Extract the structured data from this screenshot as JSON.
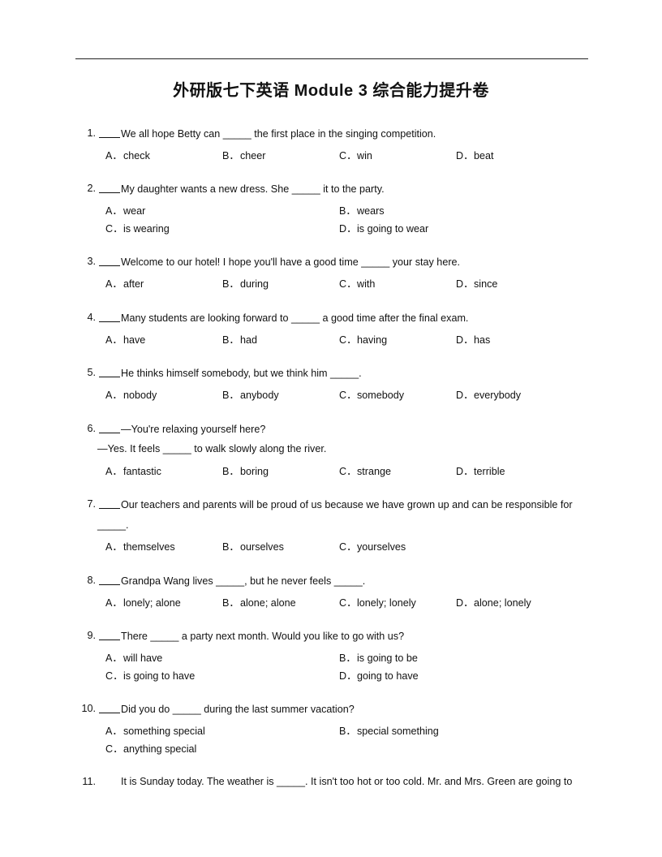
{
  "document": {
    "title_cn_prefix": "外研版七下英语",
    "title_en": "Module 3",
    "title_cn_suffix": "综合能力提升卷"
  },
  "questions": [
    {
      "number": "1.",
      "stem": "We all hope  Betty can _____ the first place in the singing competition.",
      "options": [
        {
          "letter": "A．",
          "text": "check"
        },
        {
          "letter": "B．",
          "text": "cheer"
        },
        {
          "letter": "C．",
          "text": "win"
        },
        {
          "letter": "D．",
          "text": "beat"
        }
      ]
    },
    {
      "number": "2.",
      "stem": "My daughter wants a new dress. She _____ it to the party.",
      "options": [
        {
          "letter": "A．",
          "text": "wear"
        },
        {
          "letter": "B．",
          "text": "wears"
        },
        {
          "letter": "C．",
          "text": "is wearing"
        },
        {
          "letter": "D．",
          "text": "is going to wear"
        }
      ]
    },
    {
      "number": "3.",
      "stem": "Welcome to our hotel! I hope you'll have a good time _____ your stay here.",
      "options": [
        {
          "letter": "A．",
          "text": "after"
        },
        {
          "letter": "B．",
          "text": "during"
        },
        {
          "letter": "C．",
          "text": "with"
        },
        {
          "letter": "D．",
          "text": "since"
        }
      ]
    },
    {
      "number": "4.",
      "stem": "Many students are looking forward to _____ a good time after the final exam.",
      "options": [
        {
          "letter": "A．",
          "text": "have"
        },
        {
          "letter": "B．",
          "text": "had"
        },
        {
          "letter": "C．",
          "text": "having"
        },
        {
          "letter": "D．",
          "text": "has"
        }
      ]
    },
    {
      "number": "5.",
      "stem": "He thinks himself somebody,  but we think him _____.",
      "options": [
        {
          "letter": "A．",
          "text": "nobody"
        },
        {
          "letter": "B．",
          "text": "anybody"
        },
        {
          "letter": "C．",
          "text": "somebody"
        },
        {
          "letter": "D．",
          "text": "everybody"
        }
      ]
    },
    {
      "number": "6.",
      "stem": "—You're relaxing yourself here?",
      "stem_line2": "—Yes. It feels _____ to walk slowly along the river.",
      "options": [
        {
          "letter": "A．",
          "text": "fantastic"
        },
        {
          "letter": "B．",
          "text": "boring"
        },
        {
          "letter": "C．",
          "text": "strange"
        },
        {
          "letter": "D．",
          "text": "terrible"
        }
      ]
    },
    {
      "number": "7.",
      "stem": "Our teachers and parents will be proud of us because we have grown up and can be responsible for",
      "stem_line2": "_____.",
      "options": [
        {
          "letter": "A．",
          "text": "themselves"
        },
        {
          "letter": "B．",
          "text": "ourselves"
        },
        {
          "letter": "C．",
          "text": "yourselves"
        }
      ]
    },
    {
      "number": "8.",
      "stem": "Grandpa Wang lives _____, but he never feels _____.",
      "options": [
        {
          "letter": "A．",
          "text": "lonely;  alone"
        },
        {
          "letter": "B．",
          "text": "alone; alone"
        },
        {
          "letter": "C．",
          "text": "lonely;  lonely"
        },
        {
          "letter": "D．",
          "text": "alone; lonely"
        }
      ]
    },
    {
      "number": "9.",
      "stem": "There _____ a party next month. Would you like to go with us?",
      "options": [
        {
          "letter": "A．",
          "text": "will have"
        },
        {
          "letter": "B．",
          "text": "is going  to be"
        },
        {
          "letter": "C．",
          "text": "is going  to have"
        },
        {
          "letter": "D．",
          "text": "going to have"
        }
      ]
    },
    {
      "number": "10.",
      "stem": "Did you do _____ during the last summer vacation?",
      "options": [
        {
          "letter": "A．",
          "text": "something special"
        },
        {
          "letter": "B．",
          "text": "special something"
        },
        {
          "letter": "C．",
          "text": "anything special"
        }
      ]
    },
    {
      "number": "11.",
      "stem": "It is Sunday today. The weather is _____. It isn't too hot or too cold. Mr. and Mrs. Green are going to"
    }
  ]
}
